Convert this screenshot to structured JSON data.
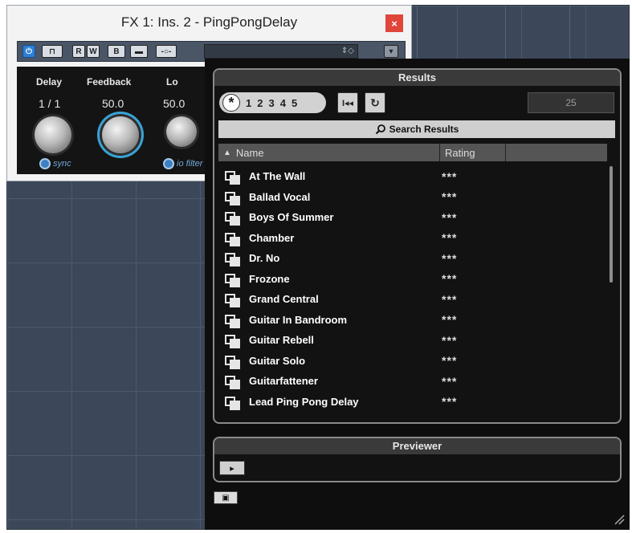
{
  "plugin": {
    "title": "FX 1: Ins. 2 - PingPongDelay",
    "close_label": "×",
    "toolbar": {
      "power_label": "⏻",
      "bypass_label": "⊓",
      "read_label": "R",
      "write_label": "W",
      "ab_label": "B",
      "copy_label": "▬",
      "preset_label": "-○-",
      "arrows_label": "⇕◇",
      "menu_label": "▾"
    },
    "knobs": [
      {
        "label": "Delay",
        "value": "1 / 1"
      },
      {
        "label": "Feedback",
        "value": "50.0"
      },
      {
        "label": "Lo",
        "value": "50.0"
      }
    ],
    "sync_label": "sync",
    "filter_label": "io filter"
  },
  "results": {
    "title": "Results",
    "rating_filter": {
      "star": "*",
      "levels": [
        "1",
        "2",
        "3",
        "4",
        "5"
      ]
    },
    "reset_btn_label": "I◂◂",
    "sync_btn_label": "↻",
    "count": "25",
    "search_label": "Search Results",
    "columns": {
      "name": "Name",
      "rating": "Rating",
      "sort_indicator": "▲"
    },
    "items": [
      {
        "name": "At The Wall",
        "rating": "***"
      },
      {
        "name": "Ballad Vocal",
        "rating": "***"
      },
      {
        "name": "Boys Of Summer",
        "rating": "***"
      },
      {
        "name": "Chamber",
        "rating": "***"
      },
      {
        "name": "Dr. No",
        "rating": "***"
      },
      {
        "name": "Frozone",
        "rating": "***"
      },
      {
        "name": "Grand Central",
        "rating": "***"
      },
      {
        "name": "Guitar In Bandroom",
        "rating": "***"
      },
      {
        "name": "Guitar Rebell",
        "rating": "***"
      },
      {
        "name": "Guitar Solo",
        "rating": "***"
      },
      {
        "name": "Guitarfattener",
        "rating": "***"
      },
      {
        "name": "Lead Ping Pong Delay",
        "rating": "***"
      }
    ]
  },
  "previewer": {
    "title": "Previewer",
    "button_label": "▸",
    "layout_btn_label": "▣"
  },
  "colors": {
    "workspace": "#3c4859",
    "panel_bg": "#0e0e0e",
    "accent_blue": "#3aa3d6",
    "close_red": "#e0453a"
  }
}
